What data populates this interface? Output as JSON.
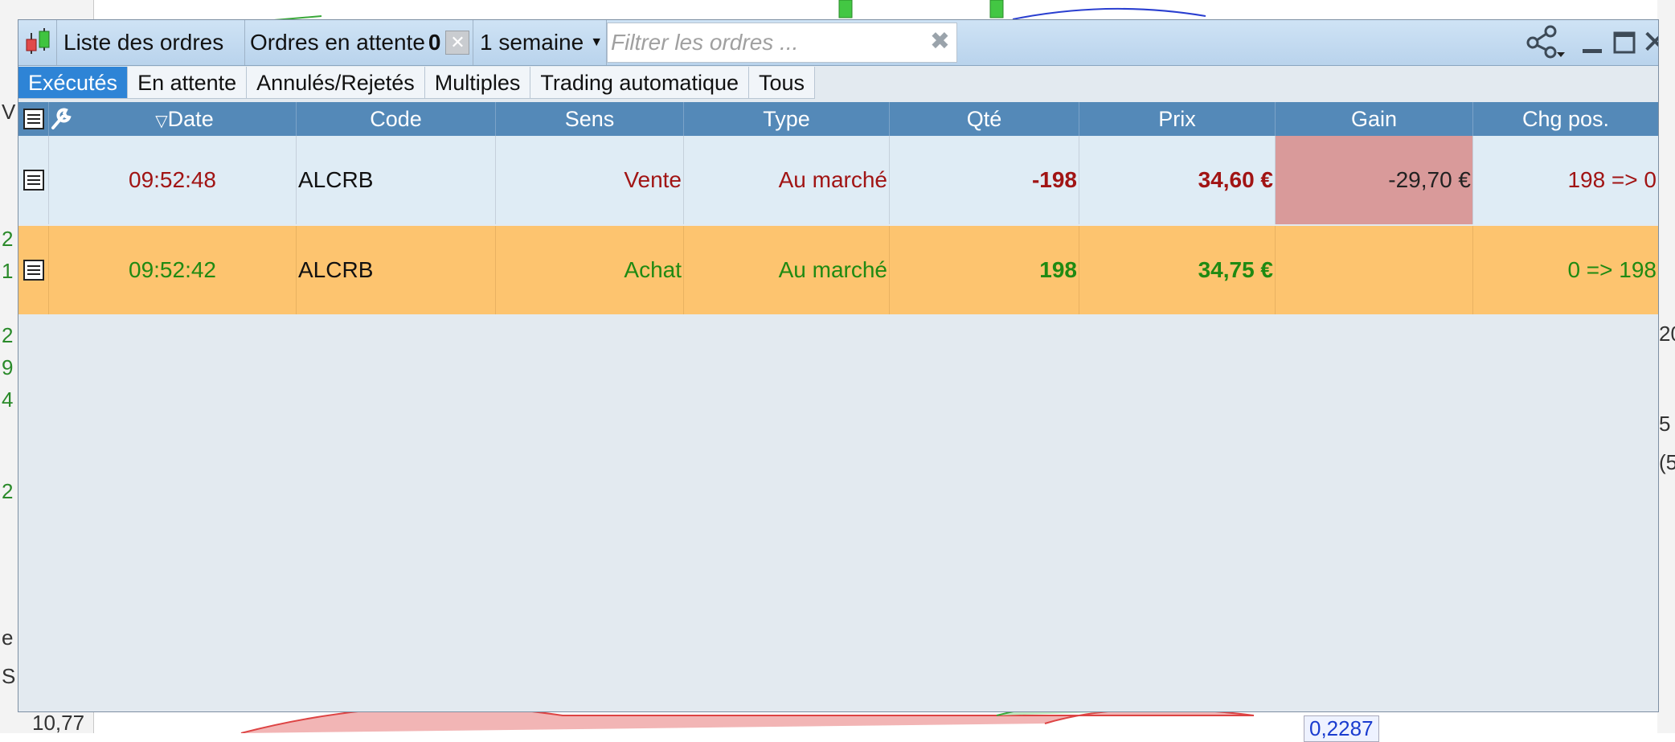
{
  "background": {
    "left_edge": [
      "V",
      "2",
      "1",
      "2",
      "9",
      "4",
      "2",
      "e",
      "S"
    ],
    "right_edge": [
      "20",
      "5",
      "(5"
    ],
    "bottom_value": "0,2287",
    "bottom_left_value": "10,77"
  },
  "window": {
    "list_label": "Liste des ordres",
    "pending_label": "Ordres en attente",
    "pending_count": "0",
    "period": "1 semaine",
    "filter_placeholder": "Filtrer les ordres ..."
  },
  "tabs": [
    {
      "label": "Exécutés",
      "active": true
    },
    {
      "label": "En attente",
      "active": false
    },
    {
      "label": "Annulés/Rejetés",
      "active": false
    },
    {
      "label": "Multiples",
      "active": false
    },
    {
      "label": "Trading automatique",
      "active": false
    },
    {
      "label": "Tous",
      "active": false
    }
  ],
  "columns": [
    "Date",
    "Code",
    "Sens",
    "Type",
    "Qté",
    "Prix",
    "Gain",
    "Chg pos."
  ],
  "rows": [
    {
      "date": "09:52:48",
      "code": "ALCRB",
      "sens": "Vente",
      "type": "Au marché",
      "qte": "-198",
      "prix": "34,60 €",
      "gain": "-29,70 €",
      "chg_pos": "198 => 0"
    },
    {
      "date": "09:52:42",
      "code": "ALCRB",
      "sens": "Achat",
      "type": "Au marché",
      "qte": "198",
      "prix": "34,75 €",
      "gain": "",
      "chg_pos": "0 => 198"
    }
  ],
  "colors": {
    "header_bg": "#5489b8",
    "tab_active": "#2e84d6",
    "sell_text": "#a11414",
    "buy_text": "#1f8a12",
    "buy_row_bg": "#fdc46f",
    "loss_cell_bg": "#d99a9a"
  }
}
